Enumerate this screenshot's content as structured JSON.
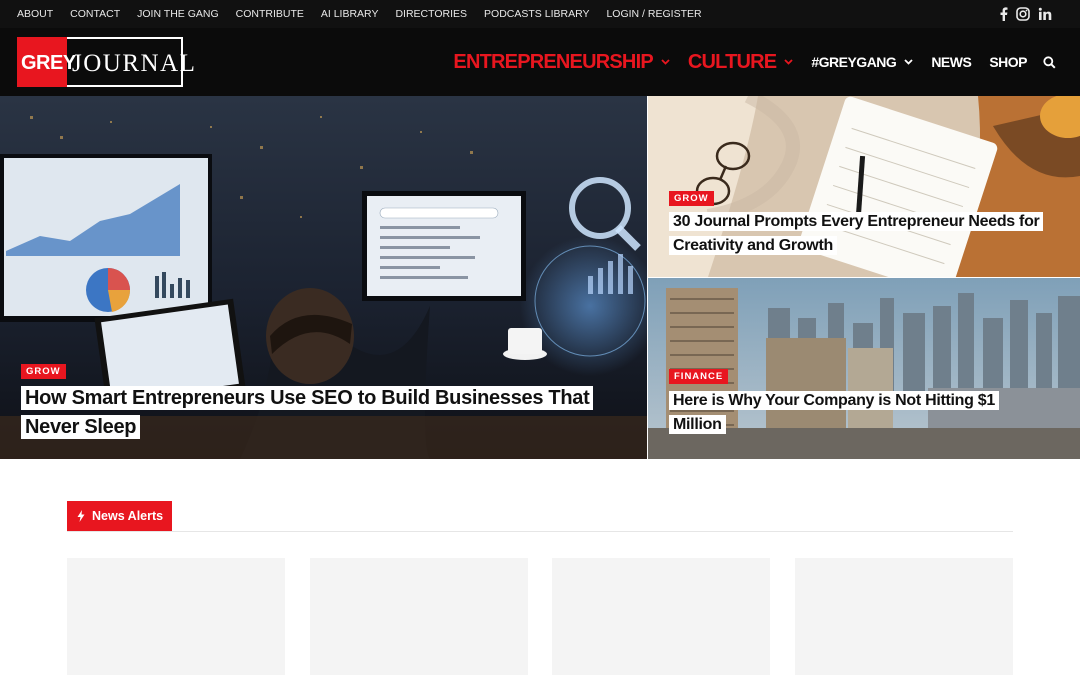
{
  "topbar": {
    "links": [
      "ABOUT",
      "CONTACT",
      "JOIN THE GANG",
      "CONTRIBUTE",
      "AI LIBRARY",
      "DIRECTORIES",
      "PODCASTS LIBRARY",
      "LOGIN / REGISTER"
    ],
    "social_icons": [
      "facebook-icon",
      "instagram-icon",
      "linkedin-icon"
    ]
  },
  "header": {
    "logo": {
      "grey": "GREY",
      "journal": "JOURNAL"
    },
    "nav": [
      {
        "label": "ENTREPRENEURSHIP",
        "dropdown": true
      },
      {
        "label": "CULTURE",
        "dropdown": true
      },
      {
        "label": "#GREYGANG",
        "dropdown": true
      },
      {
        "label": "NEWS",
        "dropdown": false
      },
      {
        "label": "SHOP",
        "dropdown": false
      }
    ],
    "search_icon": "search-icon"
  },
  "hero": {
    "main": {
      "category": "GROW",
      "title": "How Smart Entrepreneurs Use SEO to Build Businesses That Never Sleep"
    },
    "top_right": {
      "category": "GROW",
      "title": "30 Journal Prompts Every Entrepreneur Needs for Creativity and Growth"
    },
    "bottom_right": {
      "category": "FINANCE",
      "title": "Here is Why Your Company is Not Hitting $1 Million"
    }
  },
  "news_alerts": {
    "label": "News Alerts",
    "icon": "bolt-icon"
  },
  "colors": {
    "accent": "#e8161f",
    "topbar": "#111111",
    "header": "#0b0b0b",
    "card": "#f4f4f4"
  }
}
